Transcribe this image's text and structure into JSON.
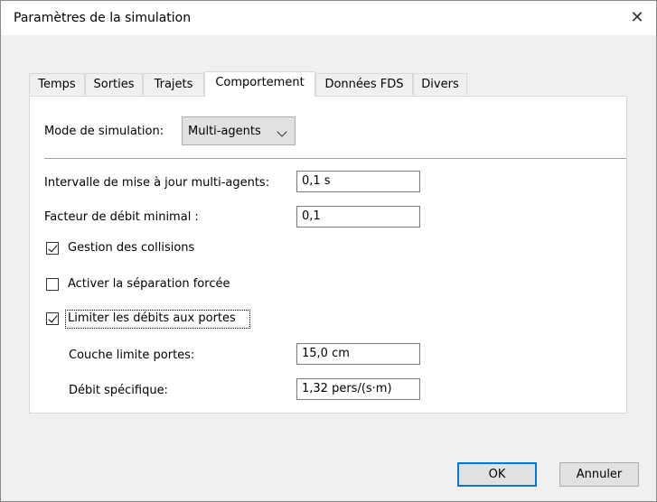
{
  "dialog": {
    "title": "Paramètres de la simulation",
    "close": "✕"
  },
  "tabs": [
    {
      "label": "Temps",
      "active": false
    },
    {
      "label": "Sorties",
      "active": false
    },
    {
      "label": "Trajets",
      "active": false
    },
    {
      "label": "Comportement",
      "active": true
    },
    {
      "label": "Données FDS",
      "active": false
    },
    {
      "label": "Divers",
      "active": false
    }
  ],
  "form": {
    "mode_label": "Mode de simulation:",
    "mode_value": "Multi-agents",
    "interval_label": "Intervalle de mise à jour multi-agents:",
    "interval_value": "0,1 s",
    "factor_label": "Facteur de débit minimal :",
    "factor_value": "0,1",
    "collisions_label": "Gestion des collisions",
    "collisions_checked": true,
    "separation_label": "Activer la séparation forcée",
    "separation_checked": false,
    "limit_label": "Limiter les débits aux portes",
    "limit_checked": true,
    "boundary_label": "Couche limite portes:",
    "boundary_value": "15,0 cm",
    "specific_label": "Débit spécifique:",
    "specific_value": "1,32 pers/(s·m)"
  },
  "buttons": {
    "ok": "OK",
    "cancel": "Annuler"
  },
  "colors": {
    "accent": "#0078d7"
  }
}
